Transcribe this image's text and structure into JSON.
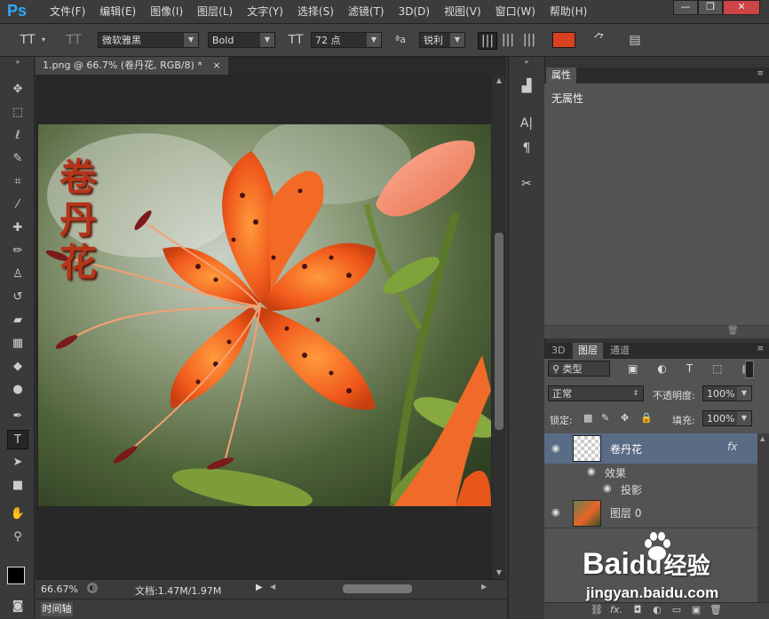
{
  "app": {
    "logo": "Ps"
  },
  "menu": [
    "文件(F)",
    "编辑(E)",
    "图像(I)",
    "图层(L)",
    "文字(Y)",
    "选择(S)",
    "滤镜(T)",
    "3D(D)",
    "视图(V)",
    "窗口(W)",
    "帮助(H)"
  ],
  "window_controls": {
    "minimize": "—",
    "restore": "❐",
    "close": "✕"
  },
  "options": {
    "font_family": "微软雅黑",
    "font_style": "Bold",
    "font_size": "72 点",
    "aa_label": "ªa",
    "anti_alias": "锐利",
    "text_color": "#d9401f"
  },
  "document": {
    "tab_title": "1.png @ 66.7% (卷丹花, RGB/8) *",
    "tab_close": "×",
    "overlay_text": [
      "卷",
      "丹",
      "花"
    ],
    "zoom": "66.67%",
    "doc_info": "文档:1.47M/1.97M"
  },
  "timeline_tab": "时间轴",
  "properties_panel": {
    "tab": "属性",
    "content": "无属性"
  },
  "layers_panel": {
    "tabs": [
      "3D",
      "图层",
      "通道"
    ],
    "filter_kind": "类型",
    "blend_mode": "正常",
    "opacity_label": "不透明度:",
    "opacity_value": "100%",
    "lock_label": "锁定:",
    "fill_label": "填充:",
    "fill_value": "100%",
    "layers": [
      {
        "name": "卷丹花",
        "fx": "fx"
      },
      {
        "name": "效果"
      },
      {
        "name": "投影"
      },
      {
        "name": "图层 0"
      }
    ],
    "bottom_fx": "fx."
  },
  "watermark": {
    "brand": "Bai",
    "brand2": "du",
    "jingyan": "经验",
    "url": "jingyan.baidu.com"
  }
}
